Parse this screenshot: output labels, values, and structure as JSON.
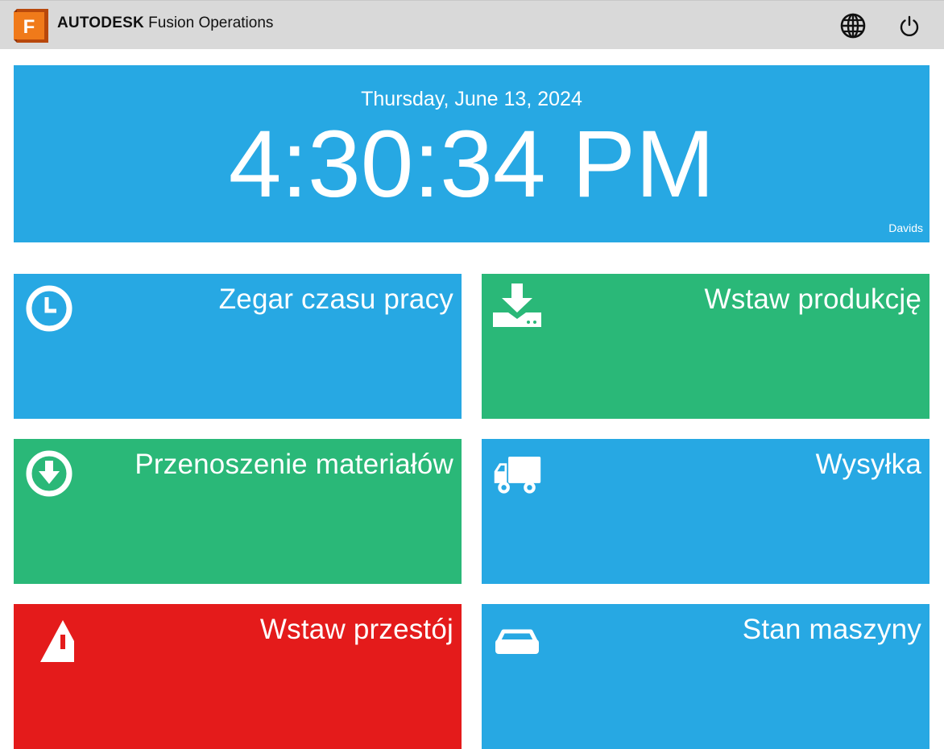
{
  "header": {
    "brand_strong": "AUTODESK",
    "brand_product": "Fusion Operations",
    "logo_letter": "F",
    "language_icon": "globe-icon",
    "logout_icon": "power-icon"
  },
  "clock": {
    "date": "Thursday, June 13, 2024",
    "time": "4:30:34 PM",
    "user": "Davids"
  },
  "tiles": [
    {
      "label": "Zegar czasu pracy",
      "icon": "clock-icon",
      "color": "#27a8e3"
    },
    {
      "label": "Wstaw produkcję",
      "icon": "download-tray-icon",
      "color": "#2ab878"
    },
    {
      "label": "Przenoszenie materiałów",
      "icon": "arrow-down-circle-icon",
      "color": "#2ab878"
    },
    {
      "label": "Wysyłka",
      "icon": "truck-icon",
      "color": "#27a8e3"
    },
    {
      "label": "Wstaw przestój",
      "icon": "warning-icon",
      "color": "#e41b1b"
    },
    {
      "label": "Stan maszyny",
      "icon": "car-icon",
      "color": "#27a8e3"
    }
  ]
}
